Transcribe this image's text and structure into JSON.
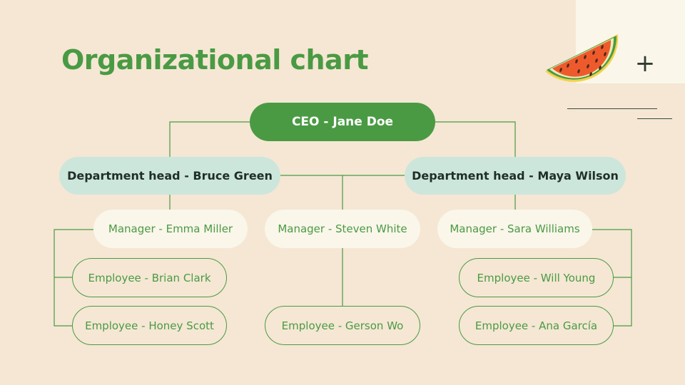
{
  "title": "Organizational chart",
  "colors": {
    "background": "#f5e7d4",
    "accent_green": "#4a9a44",
    "head_fill": "#cde6dc",
    "manager_fill": "#faf6ea"
  },
  "icons": {
    "fruit": "watermelon-slice-icon",
    "plus": "plus-icon"
  },
  "org": {
    "ceo": "CEO - Jane Doe",
    "department_heads": [
      "Department head - Bruce Green",
      "Department head - Maya Wilson"
    ],
    "managers": [
      "Manager - Emma Miller",
      "Manager - Steven White",
      "Manager - Sara Williams"
    ],
    "employees": [
      "Employee - Brian Clark",
      "Employee - Honey Scott",
      "Employee - Gerson Wo",
      "Employee - Will Young",
      "Employee - Ana García"
    ]
  }
}
